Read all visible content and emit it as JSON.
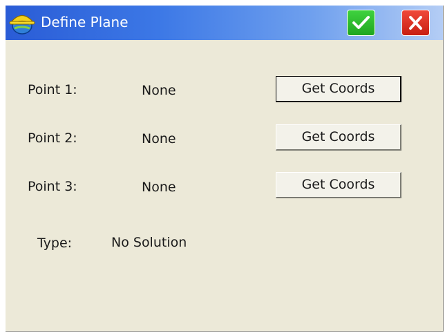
{
  "window": {
    "title": "Define Plane",
    "app_icon": "hardhat-globe-icon",
    "ok_icon": "checkmark-icon",
    "close_icon": "close-x-icon"
  },
  "points": [
    {
      "label": "Point 1:",
      "value": "None",
      "button_label": "Get Coords"
    },
    {
      "label": "Point 2:",
      "value": "None",
      "button_label": "Get Coords"
    },
    {
      "label": "Point 3:",
      "value": "None",
      "button_label": "Get Coords"
    }
  ],
  "type": {
    "label": "Type:",
    "value": "No Solution"
  },
  "colors": {
    "titlebar_start": "#2a5cd6",
    "titlebar_end": "#b4cdf5",
    "window_bg": "#ece9d8",
    "ok_green": "#1fa61f",
    "close_red": "#c81e12"
  }
}
